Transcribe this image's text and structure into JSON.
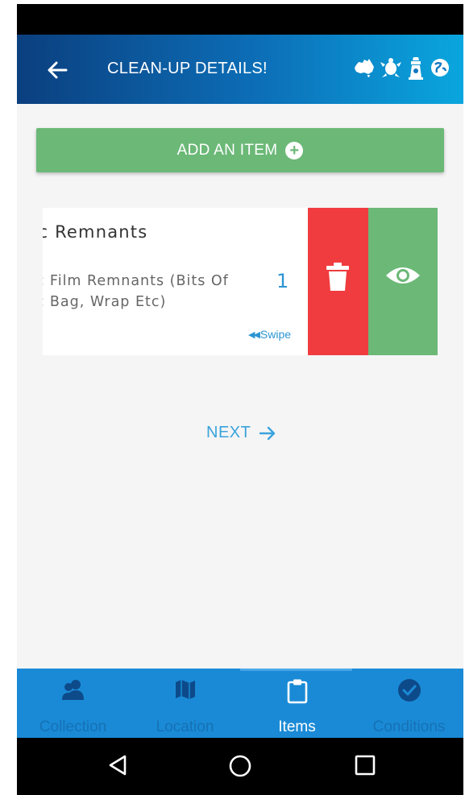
{
  "header": {
    "title": "CLEAN-UP DETAILS!",
    "logos": [
      "australia-map-icon",
      "turtle-icon",
      "lighthouse-icon",
      "globe-icon"
    ]
  },
  "add_item": {
    "label": "ADD AN ITEM"
  },
  "item": {
    "title": "tic Remnants",
    "description": "tic Film Remnants (Bits Of tic Bag, Wrap Etc)",
    "quantity": "1",
    "swipe_hint": "Swipe",
    "actions": [
      "delete",
      "view"
    ]
  },
  "next": {
    "label": "NEXT"
  },
  "bottom_nav": {
    "items": [
      {
        "label": "Collection",
        "icon": "users-icon",
        "active": false
      },
      {
        "label": "Location",
        "icon": "map-icon",
        "active": false
      },
      {
        "label": "Items",
        "icon": "clipboard-icon",
        "active": true
      },
      {
        "label": "Conditions",
        "icon": "check-circle-icon",
        "active": false
      }
    ]
  },
  "colors": {
    "header_start": "#0b3f7f",
    "header_end": "#0aa6de",
    "add_button": "#6bb877",
    "delete": "#f03c3f",
    "view": "#6bb877",
    "accent": "#2c95d3",
    "bottom_nav": "#1a8ad6"
  }
}
